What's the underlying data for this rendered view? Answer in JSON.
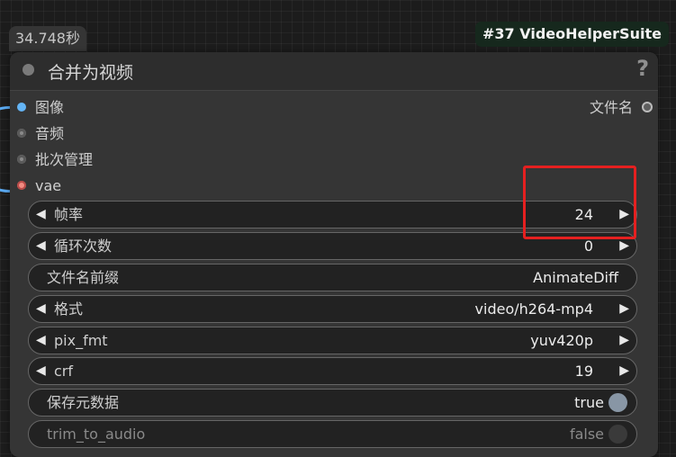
{
  "execution_time": "34.748秒",
  "node_badge": "#37 VideoHelperSuite",
  "node": {
    "title": "合并为视频",
    "help_icon": "?",
    "inputs": [
      {
        "label": "图像",
        "color": "#64b5f6"
      },
      {
        "label": "音频",
        "color": "#8a8a8a"
      },
      {
        "label": "批次管理",
        "color": "#8a8a8a"
      },
      {
        "label": "vae",
        "color": "#f28b82"
      }
    ],
    "output": {
      "label": "文件名"
    },
    "widgets": {
      "frame_rate": {
        "label": "帧率",
        "value": "24"
      },
      "loop_count": {
        "label": "循环次数",
        "value": "0"
      },
      "filename_prefix": {
        "label": "文件名前缀",
        "value": "AnimateDiff"
      },
      "format": {
        "label": "格式",
        "value": "video/h264-mp4"
      },
      "pix_fmt": {
        "label": "pix_fmt",
        "value": "yuv420p"
      },
      "crf": {
        "label": "crf",
        "value": "19"
      },
      "save_metadata": {
        "label": "保存元数据",
        "value": "true"
      },
      "trim_to_audio": {
        "label": "trim_to_audio",
        "value": "false"
      }
    },
    "arrow_left": "◀",
    "arrow_right": "▶"
  },
  "colors": {
    "highlight": "#e52020",
    "badge_bg": "#16281d",
    "wire": "#5aa9f0"
  }
}
